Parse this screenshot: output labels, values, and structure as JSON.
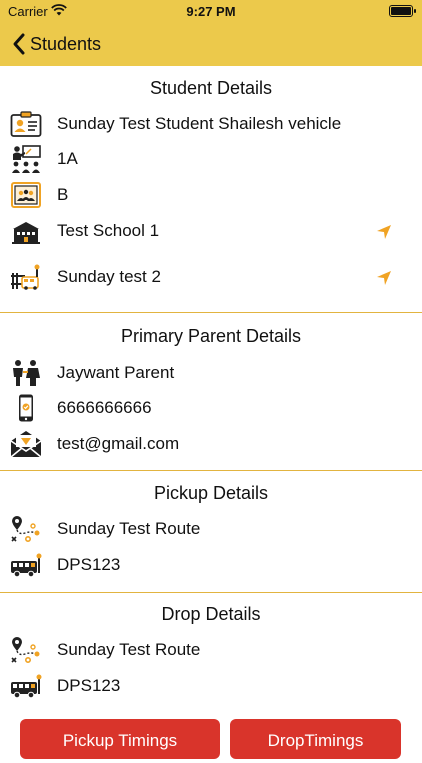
{
  "status_bar": {
    "carrier": "Carrier",
    "time": "9:27 PM"
  },
  "nav": {
    "back_label": "Students"
  },
  "student": {
    "title": "Student Details",
    "name": "Sunday Test Student Shailesh vehicle",
    "class": "1A",
    "section": "B",
    "school": "Test School 1",
    "stop": "Sunday test 2"
  },
  "parent": {
    "title": "Primary Parent Details",
    "name": "Jaywant Parent",
    "phone": "6666666666",
    "email": "test@gmail.com"
  },
  "pickup": {
    "title": "Pickup Details",
    "route": "Sunday Test Route",
    "vehicle": "DPS123"
  },
  "drop": {
    "title": "Drop Details",
    "route": "Sunday Test Route",
    "vehicle": "DPS123"
  },
  "buttons": {
    "pickup_timings": "Pickup Timings",
    "drop_timings": "DropTimings"
  },
  "colors": {
    "header": "#ecc94b",
    "accent": "#f0a324",
    "button": "#d9342b",
    "divider": "#e2b440"
  },
  "icons": [
    "id-card-icon",
    "teacher-class-icon",
    "classroom-icon",
    "school-building-icon",
    "bus-stop-icon",
    "location-arrow-icon",
    "parents-icon",
    "mobile-phone-icon",
    "email-icon",
    "route-icon",
    "bus-icon"
  ]
}
